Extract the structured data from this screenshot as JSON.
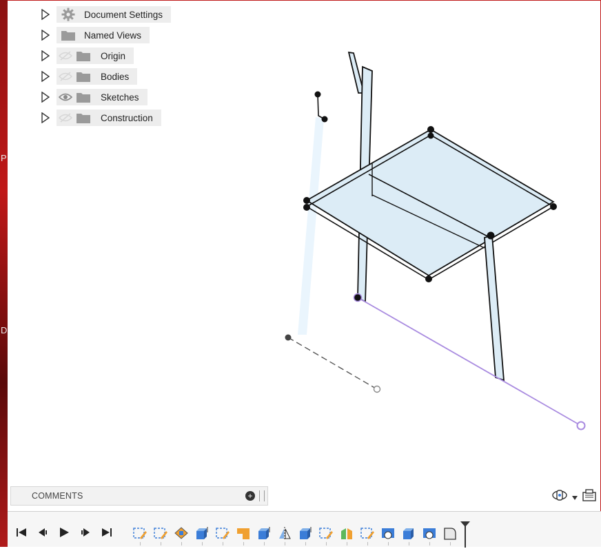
{
  "browser": {
    "items": [
      {
        "label": "Document Settings",
        "icon": "gear-icon"
      },
      {
        "label": "Named Views",
        "icon": "folder-icon"
      },
      {
        "label": "Origin",
        "icon": "folder-icon",
        "visibility": "hidden-eye-icon"
      },
      {
        "label": "Bodies",
        "icon": "folder-icon",
        "visibility": "hidden-eye-icon"
      },
      {
        "label": "Sketches",
        "icon": "folder-icon",
        "visibility": "eye-icon"
      },
      {
        "label": "Construction",
        "icon": "folder-icon",
        "visibility": "hidden-eye-icon"
      }
    ]
  },
  "comments": {
    "title": "COMMENTS"
  },
  "edge_letters": [
    "P",
    "D"
  ],
  "timeline": {
    "playback": [
      "skip-to-start-icon",
      "step-back-icon",
      "play-icon",
      "step-forward-icon",
      "skip-to-end-icon"
    ],
    "features": [
      "sketch",
      "sketch",
      "form",
      "extrude",
      "sketch",
      "shell",
      "extrude",
      "mirror",
      "extrude",
      "sketch",
      "split",
      "sketch",
      "combine",
      "extrude",
      "combine",
      "fillet"
    ]
  },
  "colors": {
    "accent_red": "#c01818",
    "sketch_purple": "#a98be0",
    "body_fill": "#dcecf6"
  }
}
